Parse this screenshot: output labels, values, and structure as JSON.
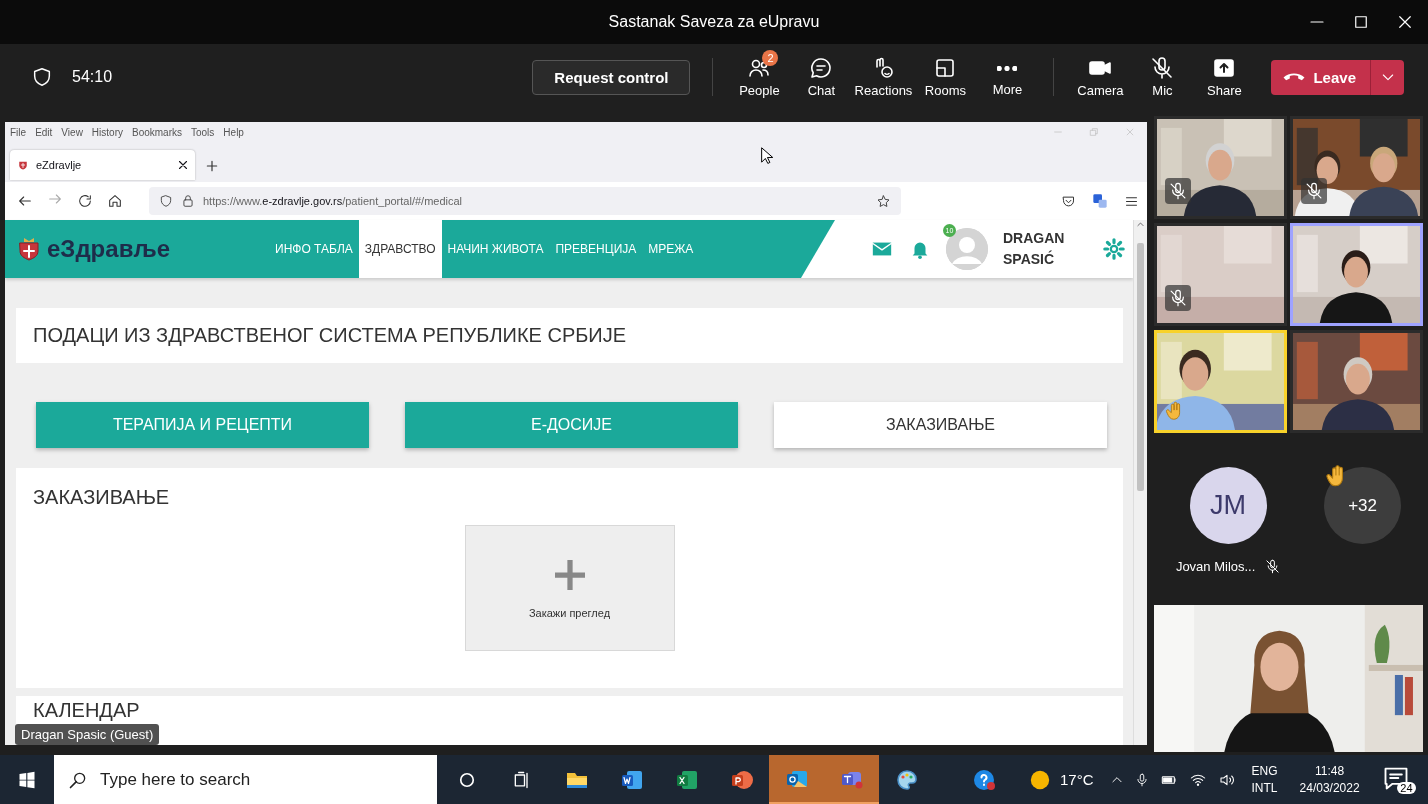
{
  "window": {
    "title": "Sastanak Saveza za eUpravu"
  },
  "meeting_bar": {
    "timer": "54:10",
    "request_control": "Request control",
    "actions": [
      {
        "kind": "people",
        "label": "People",
        "badge": "2"
      },
      {
        "kind": "chat",
        "label": "Chat"
      },
      {
        "kind": "reactions",
        "label": "Reactions"
      },
      {
        "kind": "rooms",
        "label": "Rooms"
      },
      {
        "kind": "more",
        "label": "More"
      }
    ],
    "devices": [
      {
        "kind": "camera",
        "label": "Camera",
        "muted": false
      },
      {
        "kind": "mic",
        "label": "Mic",
        "muted": true
      },
      {
        "kind": "share",
        "label": "Share"
      }
    ],
    "leave": "Leave"
  },
  "browser": {
    "menu": [
      "File",
      "Edit",
      "View",
      "History",
      "Bookmarks",
      "Tools",
      "Help"
    ],
    "tabs": [
      {
        "title": "eZdravlje",
        "selected": true
      }
    ],
    "url": "https://www.**e-zdravlje.gov.rs**/patient_portal/#/medical"
  },
  "site": {
    "logo": "eЗдравље",
    "nav": [
      {
        "label": "ИНФО ТАБЛА",
        "selected": false
      },
      {
        "label": "ЗДРАВСТВО",
        "selected": true
      },
      {
        "label": "НАЧИН ЖИВОТА",
        "selected": false
      },
      {
        "label": "ПРЕВЕНЦИЈА",
        "selected": false
      },
      {
        "label": "МРЕЖА",
        "selected": false
      }
    ],
    "avatar_badge": "10",
    "user": "DRAGAN SPASIĆ",
    "page_title": "ПОДАЦИ ИЗ ЗДРАВСТВЕНОГ СИСТЕМА РЕПУБЛИКЕ СРБИЈЕ",
    "section_buttons": [
      {
        "label": "ТЕРАПИЈА И РЕЦЕПТИ",
        "selected": false
      },
      {
        "label": "Е-ДОСИЈЕ",
        "selected": false
      },
      {
        "label": "ЗАКАЗИВАЊЕ",
        "selected": true
      }
    ],
    "scheduling": {
      "title": "ЗАКАЗИВАЊЕ",
      "add_label": "Закажи преглед"
    },
    "calendar_title": "КАЛЕНДАР"
  },
  "presenter_label": "Dragan Spasic (Guest)",
  "participants": {
    "tiles": [
      {
        "muted": true,
        "speaking": false,
        "raised_hand": false
      },
      {
        "muted": true,
        "speaking": false,
        "raised_hand": false
      },
      {
        "muted": true,
        "speaking": false,
        "raised_hand": false
      },
      {
        "muted": false,
        "speaking": true,
        "raised_hand": false
      },
      {
        "muted": false,
        "speaking": false,
        "raised_hand": true
      },
      {
        "muted": false,
        "speaking": false,
        "raised_hand": false
      }
    ],
    "avatar": {
      "initials": "JM",
      "name": "Jovan Milos...",
      "muted": true
    },
    "overflow": {
      "count": "+32",
      "raised_hand": true
    }
  },
  "taskbar": {
    "search_placeholder": "Type here to search",
    "apps": [
      {
        "kind": "cortana",
        "active": false
      },
      {
        "kind": "taskview",
        "active": false
      },
      {
        "kind": "explorer",
        "active": false
      },
      {
        "kind": "word",
        "active": false
      },
      {
        "kind": "excel",
        "active": false
      },
      {
        "kind": "powerpoint",
        "active": false
      },
      {
        "kind": "outlook",
        "active": true
      },
      {
        "kind": "teams",
        "active": true
      },
      {
        "kind": "paint",
        "active": false
      },
      {
        "kind": "help",
        "active": false
      }
    ],
    "temperature": "17°C",
    "language": [
      "ENG",
      "INTL"
    ],
    "time": "11:48",
    "date": "24/03/2022",
    "notifications": "24"
  }
}
